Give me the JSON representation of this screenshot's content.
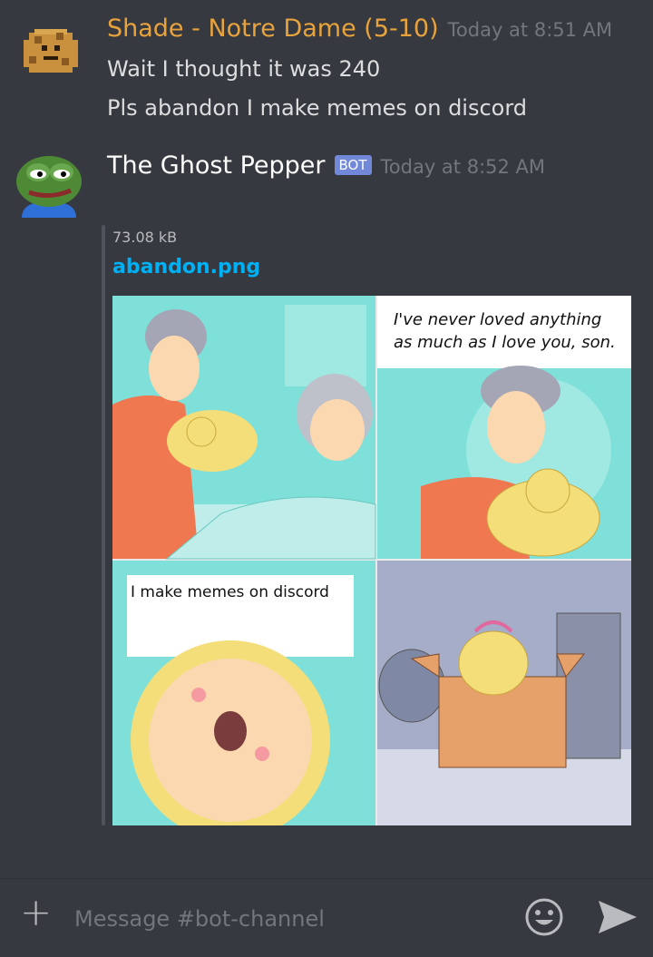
{
  "messages": [
    {
      "username": "Shade - Notre Dame (5-10)",
      "username_color": "#e8a33d",
      "timestamp": "Today at 8:51 AM",
      "lines": [
        "Wait I thought it was 240",
        "Pls abandon I make memes on discord"
      ]
    },
    {
      "username": "The Ghost Pepper",
      "username_color": "#ffffff",
      "bot_tag": "BOT",
      "timestamp": "Today at 8:52 AM",
      "attachment": {
        "size": "73.08 kB",
        "filename": "abandon.png",
        "captions": {
          "top_right_line1": "I've never loved anything",
          "top_right_line2": "as much as I love you, son.",
          "bottom_left": "I make memes on discord"
        }
      }
    }
  ],
  "composer": {
    "placeholder": "Message #bot-channel",
    "add_icon": "plus-icon",
    "emoji_icon": "smiley-icon",
    "send_icon": "send-arrow-icon"
  },
  "colors": {
    "background": "#36393f",
    "link": "#00b0f4",
    "bot_tag": "#7289da"
  }
}
